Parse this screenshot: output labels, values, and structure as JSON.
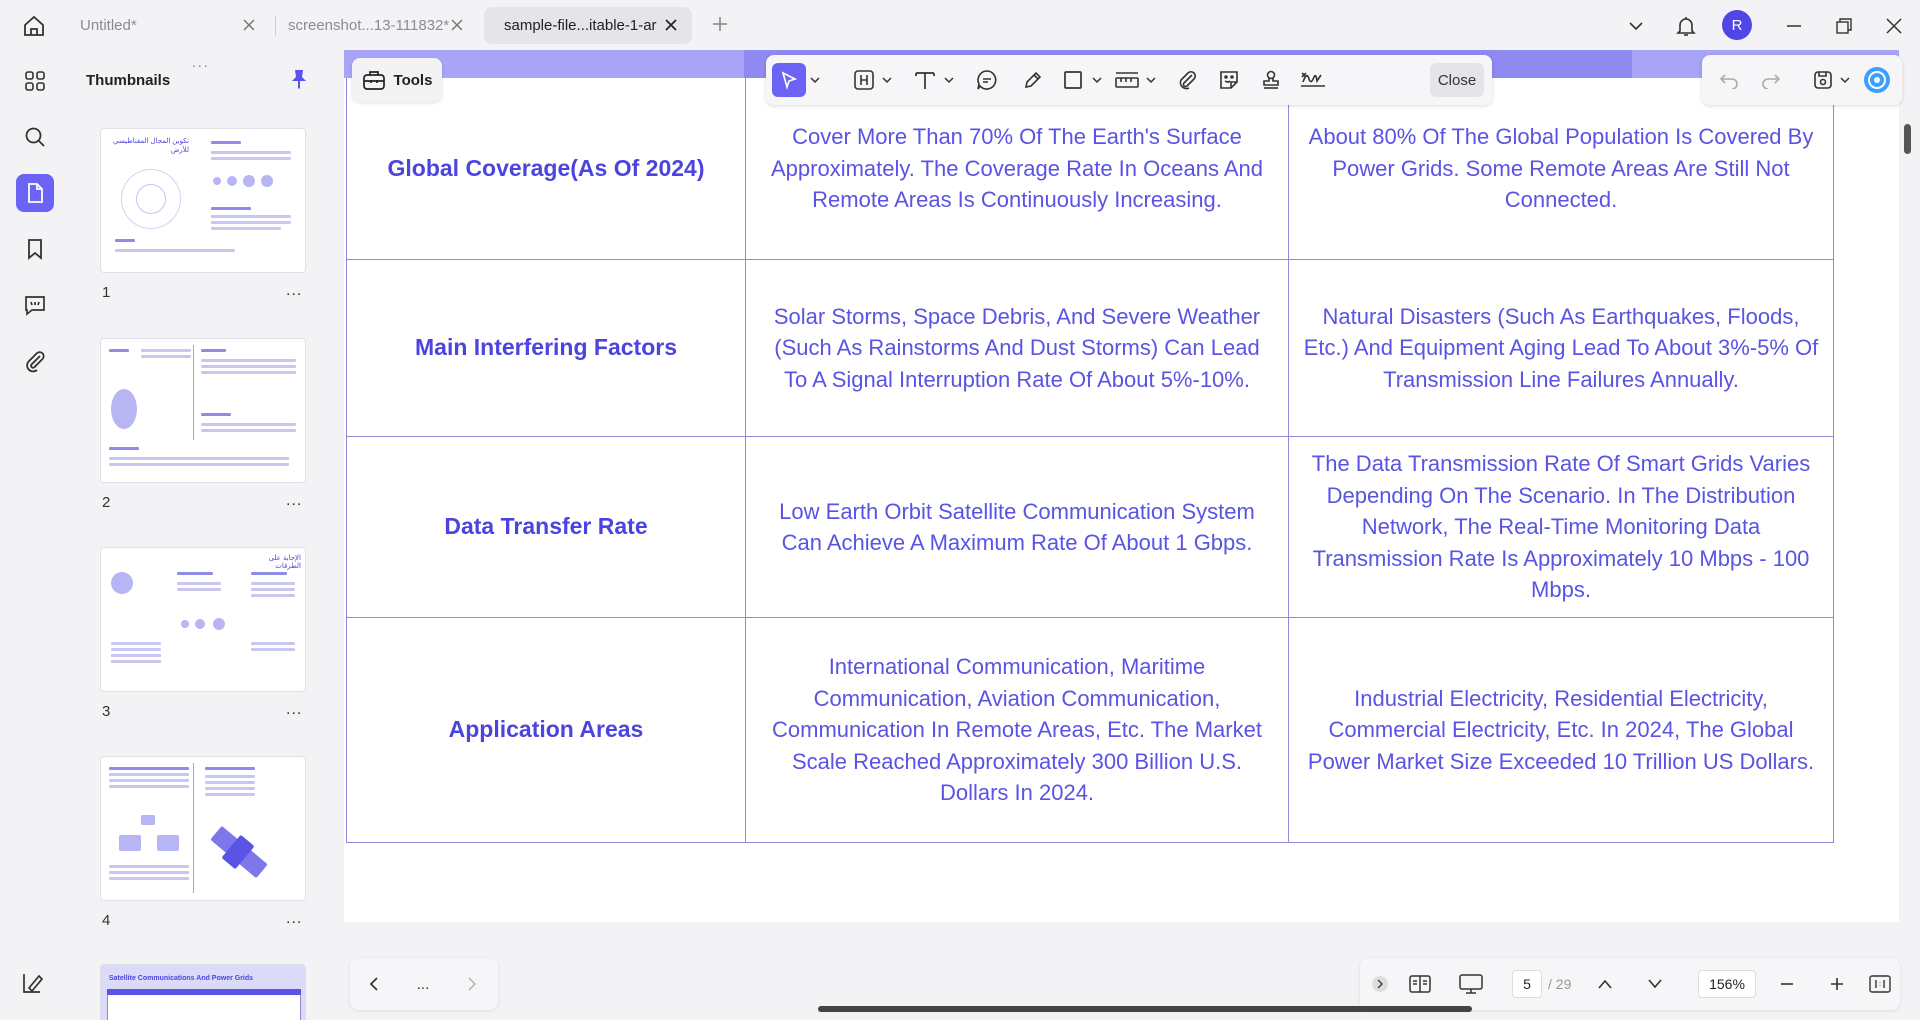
{
  "tabs": [
    {
      "label": "Untitled*",
      "active": false
    },
    {
      "label": "screenshot...13-111832*",
      "active": false
    },
    {
      "label": "sample-file...itable-1-ar",
      "active": true
    }
  ],
  "user": {
    "initial": "R",
    "color": "#4f46e5"
  },
  "thumbnails": {
    "title": "Thumbnails",
    "grip": "...",
    "pages": [
      {
        "number": "1",
        "more": "..."
      },
      {
        "number": "2",
        "more": "..."
      },
      {
        "number": "3",
        "more": "..."
      },
      {
        "number": "4",
        "more": "..."
      }
    ],
    "page5_title": "Satellite Communications And Power Grids",
    "page1_heading": "تكوين المجال المغناطيسي للأرض",
    "page3_heading": "الإجابة على الطرقات"
  },
  "toolbar": {
    "tools_label": "Tools",
    "close_label": "Close"
  },
  "table": {
    "rows": [
      {
        "header": "Global Coverage(As Of 2024)",
        "satellite": "Cover More Than 70% Of The Earth's Surface Approximately. The Coverage Rate In Oceans And Remote Areas Is Continuously Increasing.",
        "grid": "About 80% Of The Global Population Is Covered By Power Grids. Some Remote Areas Are Still Not Connected."
      },
      {
        "header": "Main Interfering Factors",
        "satellite": "Solar Storms, Space Debris, And Severe Weather (Such As Rainstorms And Dust Storms) Can Lead To A Signal Interruption Rate Of About 5%-10%.",
        "grid": "Natural Disasters (Such As Earthquakes, Floods, Etc.) And Equipment Aging Lead To About 3%-5% Of Transmission Line Failures Annually."
      },
      {
        "header": "Data Transfer Rate",
        "satellite": "Low Earth Orbit Satellite Communication System Can Achieve A Maximum Rate Of About 1 Gbps.",
        "grid": "The Data Transmission Rate Of Smart Grids Varies Depending On The Scenario. In The Distribution Network, The Real-Time Monitoring Data Transmission Rate Is Approximately 10 Mbps - 100 Mbps."
      },
      {
        "header": "Application Areas",
        "satellite": "International Communication, Maritime Communication, Aviation Communication, Communication In Remote Areas, Etc. The Market Scale Reached Approximately 300 Billion U.S. Dollars In 2024.",
        "grid": "Industrial Electricity, Residential Electricity, Commercial Electricity, Etc. In 2024, The Global Power Market Size Exceeded 10 Trillion US Dollars."
      }
    ]
  },
  "pagination": {
    "current_page": "5",
    "total": "/ 29",
    "zoom": "156%",
    "more": "..."
  },
  "colors": {
    "accent": "#6b63f5",
    "table_text": "#5a53e3",
    "band": "#a8a4f7"
  }
}
